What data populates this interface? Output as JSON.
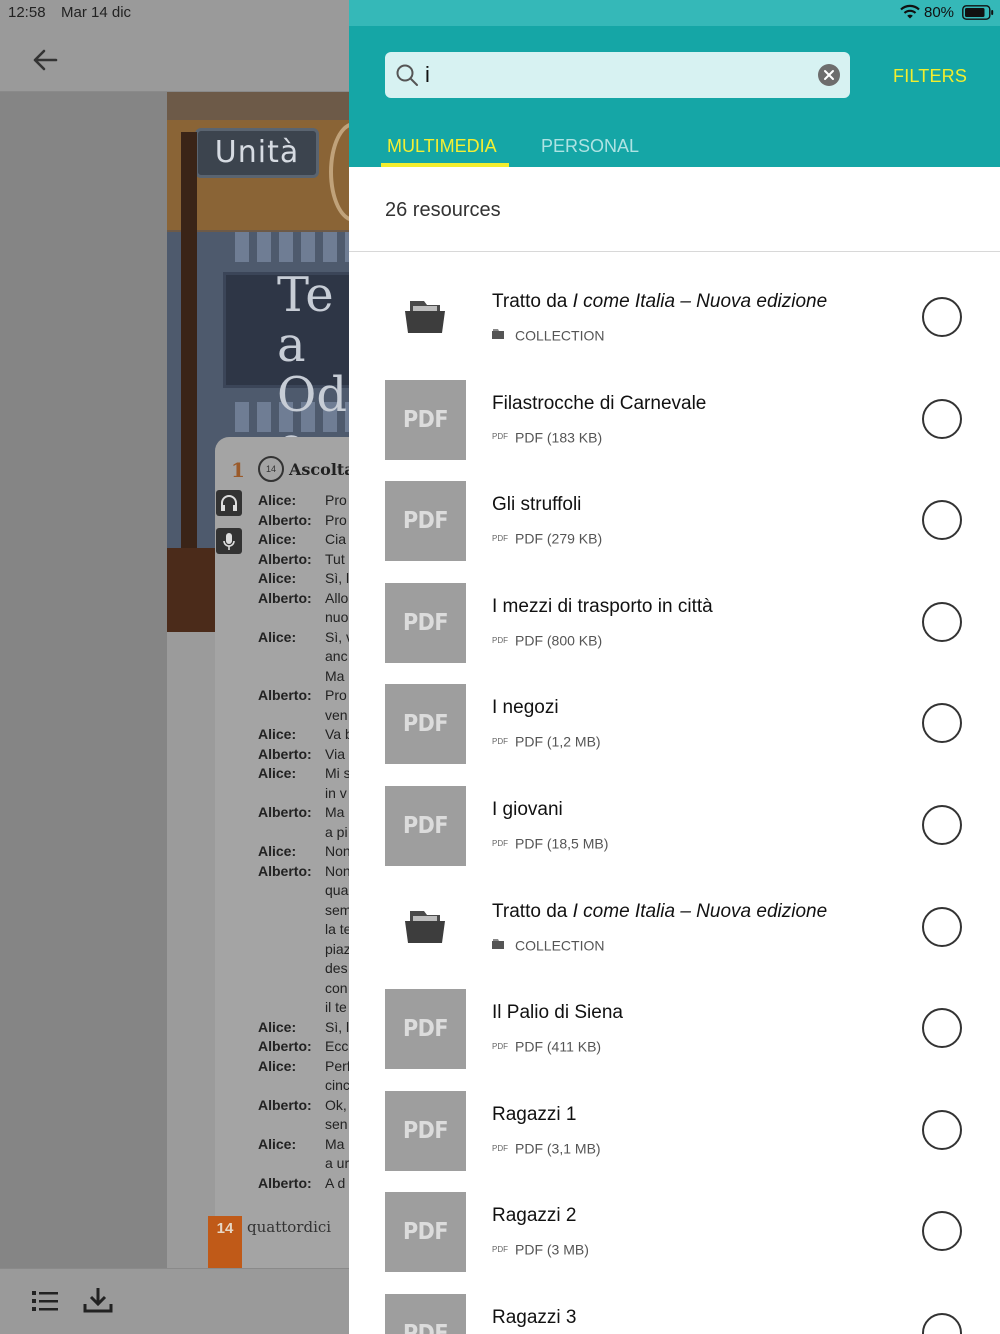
{
  "status": {
    "time": "12:58",
    "date": "Mar 14 dic",
    "battery_pct": "80%"
  },
  "book_page": {
    "unit_label": "Unità",
    "sign_text": "Tea Ode",
    "exercise_number": "1",
    "audio_track": "14",
    "exercise_title": "Ascolta e",
    "dialogue": [
      {
        "speaker": "Alice:",
        "line": "Pro"
      },
      {
        "speaker": "Alberto:",
        "line": "Pro"
      },
      {
        "speaker": "Alice:",
        "line": "Cia"
      },
      {
        "speaker": "Alberto:",
        "line": "Tut"
      },
      {
        "speaker": "Alice:",
        "line": "Sì, l"
      },
      {
        "speaker": "Alberto:",
        "line": "Allo"
      },
      {
        "speaker": "",
        "line": "nuo"
      },
      {
        "speaker": "Alice:",
        "line": "Sì, v"
      },
      {
        "speaker": "",
        "line": "anc"
      },
      {
        "speaker": "",
        "line": "Ma"
      },
      {
        "speaker": "Alberto:",
        "line": "Pro"
      },
      {
        "speaker": "",
        "line": "ven"
      },
      {
        "speaker": "Alice:",
        "line": "Va b"
      },
      {
        "speaker": "Alberto:",
        "line": "Via"
      },
      {
        "speaker": "Alice:",
        "line": "Mi s"
      },
      {
        "speaker": "",
        "line": "in v"
      },
      {
        "speaker": "Alberto:",
        "line": "Ma"
      },
      {
        "speaker": "",
        "line": "a pi"
      },
      {
        "speaker": "Alice:",
        "line": "Non"
      },
      {
        "speaker": "Alberto:",
        "line": "Non"
      },
      {
        "speaker": "",
        "line": "qua"
      },
      {
        "speaker": "",
        "line": "sem"
      },
      {
        "speaker": "",
        "line": "la te"
      },
      {
        "speaker": "",
        "line": "piaz"
      },
      {
        "speaker": "",
        "line": "des"
      },
      {
        "speaker": "",
        "line": "con"
      },
      {
        "speaker": "",
        "line": "il te"
      },
      {
        "speaker": "Alice:",
        "line": "Sì, l"
      },
      {
        "speaker": "Alberto:",
        "line": "Ecc"
      },
      {
        "speaker": "Alice:",
        "line": "Perf"
      },
      {
        "speaker": "",
        "line": "cinc"
      },
      {
        "speaker": "Alberto:",
        "line": "Ok,"
      },
      {
        "speaker": "",
        "line": "sen"
      },
      {
        "speaker": "Alice:",
        "line": "Ma"
      },
      {
        "speaker": "",
        "line": "a ur"
      },
      {
        "speaker": "Alberto:",
        "line": "A d"
      }
    ],
    "page_number": "14",
    "page_word": "quattordici"
  },
  "panel": {
    "search": {
      "value": "i"
    },
    "filters_label": "FILTERS",
    "tabs": [
      {
        "label": "MULTIMEDIA",
        "active": true
      },
      {
        "label": "PERSONAL",
        "active": false
      }
    ],
    "count_label": "26 resources",
    "colors": {
      "header": "#15a6a6",
      "accent": "#f2ee2e"
    },
    "items": [
      {
        "kind": "collection",
        "title_prefix": "Tratto da ",
        "title_italic": "I come Italia – Nuova edizione",
        "meta": "COLLECTION",
        "meta_icon": "folder-icon"
      },
      {
        "kind": "pdf",
        "thumb_label": "PDF",
        "title": "Filastrocche di Carnevale",
        "meta_icon_text": "PDF",
        "meta": "PDF (183 KB)"
      },
      {
        "kind": "pdf",
        "thumb_label": "PDF",
        "title": "Gli struffoli",
        "meta_icon_text": "PDF",
        "meta": "PDF (279 KB)"
      },
      {
        "kind": "pdf",
        "thumb_label": "PDF",
        "title": "I mezzi di trasporto in città",
        "meta_icon_text": "PDF",
        "meta": "PDF (800 KB)"
      },
      {
        "kind": "pdf",
        "thumb_label": "PDF",
        "title": "I negozi",
        "meta_icon_text": "PDF",
        "meta": "PDF (1,2 MB)"
      },
      {
        "kind": "pdf",
        "thumb_label": "PDF",
        "title": "I giovani",
        "meta_icon_text": "PDF",
        "meta": "PDF (18,5 MB)"
      },
      {
        "kind": "collection",
        "title_prefix": "Tratto da ",
        "title_italic": "I come Italia – Nuova edizione",
        "meta": "COLLECTION",
        "meta_icon": "folder-icon"
      },
      {
        "kind": "pdf",
        "thumb_label": "PDF",
        "title": "Il Palio di Siena",
        "meta_icon_text": "PDF",
        "meta": "PDF (411 KB)"
      },
      {
        "kind": "pdf",
        "thumb_label": "PDF",
        "title": "Ragazzi 1",
        "meta_icon_text": "PDF",
        "meta": "PDF (3,1 MB)"
      },
      {
        "kind": "pdf",
        "thumb_label": "PDF",
        "title": "Ragazzi 2",
        "meta_icon_text": "PDF",
        "meta": "PDF (3 MB)"
      },
      {
        "kind": "pdf",
        "thumb_label": "PDF",
        "title": "Ragazzi 3",
        "meta_icon_text": "",
        "meta": ""
      }
    ]
  }
}
